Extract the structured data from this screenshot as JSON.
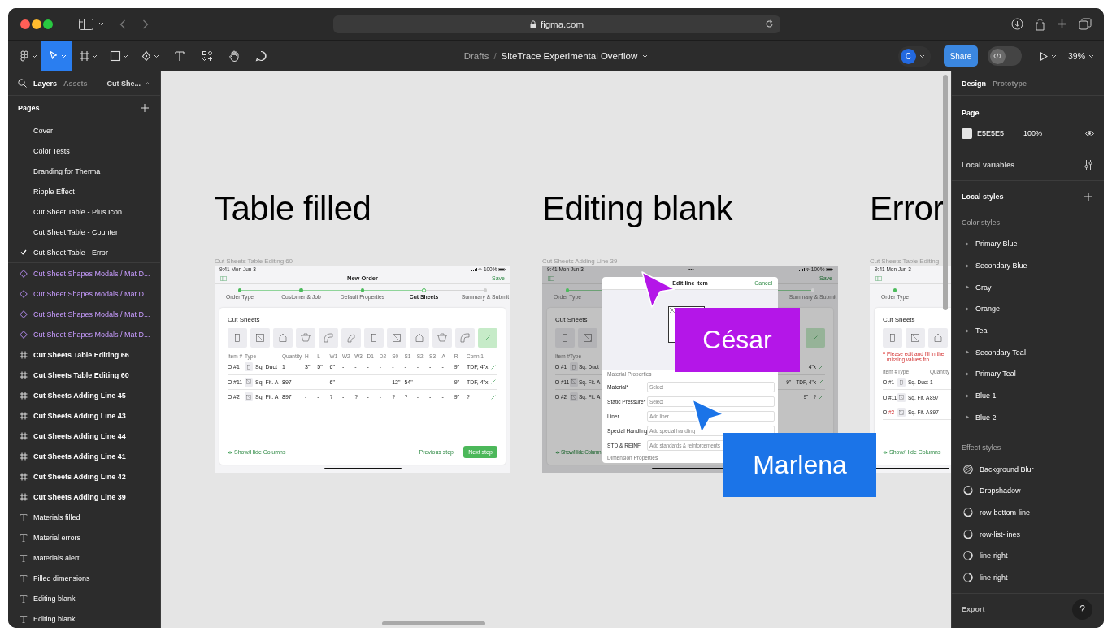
{
  "browser": {
    "url": "figma.com"
  },
  "toolbar": {
    "tools": [
      {
        "selected": false
      },
      {
        "selected": true
      },
      {
        "selected": false
      },
      {
        "selected": false
      },
      {
        "selected": false
      },
      {
        "selected": false
      },
      {
        "selected": false
      },
      {
        "selected": false
      },
      {
        "selected": false
      }
    ],
    "location": "Drafts",
    "separator": "/",
    "file_name": "SiteTrace Experimental Overflow",
    "avatar": "C",
    "share": "Share",
    "dev_mode": false,
    "zoom": "39%"
  },
  "left_panel": {
    "tabs": [
      {
        "label": "Layers",
        "selected": true
      },
      {
        "label": "Assets",
        "selected": false
      }
    ],
    "page_picker": "Cut She...",
    "pages_title": "Pages",
    "pages": [
      {
        "label": "Cover",
        "selected": false
      },
      {
        "label": "Color Tests",
        "selected": false
      },
      {
        "label": "Branding for Therma",
        "selected": false
      },
      {
        "label": "Ripple Effect",
        "selected": false
      },
      {
        "label": "Cut Sheet Table - Plus Icon",
        "selected": false
      },
      {
        "label": "Cut Sheet Table - Counter",
        "selected": false
      },
      {
        "label": "Cut Sheet Table - Error",
        "selected": true
      }
    ],
    "layers": [
      {
        "kind": "component",
        "label": "Cut Sheet Shapes Modals / Mat D..."
      },
      {
        "kind": "component",
        "label": "Cut Sheet Shapes Modals / Mat D..."
      },
      {
        "kind": "component",
        "label": "Cut Sheet Shapes Modals / Mat D..."
      },
      {
        "kind": "component",
        "label": "Cut Sheet Shapes Modals / Mat D..."
      },
      {
        "kind": "frame",
        "label": "Cut Sheets Table Editing 66"
      },
      {
        "kind": "frame",
        "label": "Cut Sheets Table Editing 60"
      },
      {
        "kind": "frame",
        "label": "Cut Sheets Adding Line 45"
      },
      {
        "kind": "frame",
        "label": "Cut Sheets Adding Line 43"
      },
      {
        "kind": "frame",
        "label": "Cut Sheets Adding Line 44"
      },
      {
        "kind": "frame",
        "label": "Cut Sheets Adding Line 41"
      },
      {
        "kind": "frame",
        "label": "Cut Sheets Adding Line 42"
      },
      {
        "kind": "frame",
        "label": "Cut Sheets Adding Line 39"
      },
      {
        "kind": "text",
        "label": "Materials filled"
      },
      {
        "kind": "text",
        "label": "Material errors"
      },
      {
        "kind": "text",
        "label": "Materials alert"
      },
      {
        "kind": "text",
        "label": "Filled dimensions"
      },
      {
        "kind": "text",
        "label": "Editing blank"
      },
      {
        "kind": "text",
        "label": "Editing blank"
      }
    ]
  },
  "canvas": {
    "sections": [
      {
        "heading": "Table filled",
        "frame": {
          "label": "Cut Sheets Table Editing 60",
          "status": {
            "time": "9:41 Mon Jun 3",
            "battery": "100%"
          },
          "nav": {
            "title": "New Order",
            "action": "Save"
          },
          "steps": [
            {
              "label": "Order Type",
              "done": true,
              "current": false
            },
            {
              "label": "Customer & Job",
              "done": true,
              "current": false
            },
            {
              "label": "Default Properties",
              "done": true,
              "current": false
            },
            {
              "label": "Cut Sheets",
              "done": false,
              "current": true
            },
            {
              "label": "Summary & Submit",
              "done": false,
              "current": false
            }
          ],
          "card_title": "Cut Sheets",
          "tiles": [
            {
              "selected": false
            },
            {
              "selected": false
            },
            {
              "selected": false
            },
            {
              "selected": false
            },
            {
              "selected": false
            },
            {
              "selected": false
            },
            {
              "selected": false
            },
            {
              "selected": false
            },
            {
              "selected": false
            },
            {
              "selected": false
            },
            {
              "selected": false
            },
            {
              "selected": true
            }
          ],
          "columns": [
            "Item #",
            "Type",
            "Quantity",
            "H",
            "L",
            "W1",
            "W2",
            "W3",
            "D1",
            "D2",
            "S0",
            "S1",
            "S2",
            "S3",
            "A",
            "R",
            "Conn 1"
          ],
          "rows": [
            {
              "checked": false,
              "error": false,
              "cells": [
                "#1",
                "Sq. Duct",
                "1",
                "3\"",
                "5\"",
                "6\"",
                "-",
                "-",
                "-",
                "-",
                "-",
                "-",
                "-",
                "-",
                "-",
                "9\"",
                "TDF, 4\"x"
              ]
            },
            {
              "checked": false,
              "error": false,
              "cells": [
                "#11",
                "Sq. Fit. A",
                "897",
                "-",
                "-",
                "6\"",
                "-",
                "-",
                "-",
                "-",
                "12\"",
                "54\"",
                "-",
                "-",
                "-",
                "9\"",
                "TDF, 4\"x"
              ]
            },
            {
              "checked": false,
              "error": false,
              "cells": [
                "#2",
                "Sq. Fit. A",
                "897",
                "-",
                "-",
                "?",
                "-",
                "?",
                "-",
                "-",
                "?",
                "?",
                "-",
                "-",
                "-",
                "9\"",
                "?"
              ]
            }
          ],
          "row_edit": true,
          "footer": {
            "toggle": "Show/Hide Columns",
            "previous": "Previous step",
            "next": "Next step"
          }
        }
      },
      {
        "heading": "Editing blank",
        "frame": {
          "label": "Cut Sheets Adding Line 39",
          "status": {
            "time": "9:41 Mon Jun 3",
            "center": "•••",
            "battery": "100%"
          },
          "nav": {
            "action": "Save"
          },
          "steps": [
            {
              "label": "Order Type",
              "done": true,
              "current": false
            },
            {
              "label": "Summary & Submit",
              "done": false,
              "current": false
            }
          ],
          "card_title": "Cut Sheets",
          "tiles": [
            {
              "selected": false
            },
            {
              "selected": false
            },
            {
              "selected": true
            }
          ],
          "columns": [
            "Item #",
            "Type"
          ],
          "rows": [
            {
              "checked": false,
              "error": false,
              "cells": [
                "#1",
                "Sq. Duct"
              ],
              "tail": [
                "4\"x"
              ]
            },
            {
              "checked": false,
              "error": false,
              "cells": [
                "#11",
                "Sq. Fit. A"
              ],
              "tail": [
                "9\"",
                "TDF, 4\"x"
              ]
            },
            {
              "checked": false,
              "error": false,
              "cells": [
                "#2",
                "Sq. Fit. A"
              ],
              "tail": [
                "9\"",
                "?"
              ]
            }
          ],
          "row_edit": true,
          "footer": {
            "toggle": "Show/Hide Column"
          },
          "modal": {
            "title": "Edit line item",
            "cancel": "Cancel",
            "section": "Material Properties",
            "fields": [
              {
                "label": "Material*",
                "placeholder": "Select"
              },
              {
                "label": "Static Pressure*",
                "placeholder": "Select"
              },
              {
                "label": "Liner",
                "placeholder": "Add liner"
              },
              {
                "label": "Special Handling",
                "placeholder": "Add special handling"
              },
              {
                "label": "STD & REINF",
                "placeholder": "Add standards & reinforcements"
              }
            ],
            "next_section": "Dimension Properties"
          }
        }
      },
      {
        "heading": "Error",
        "frame": {
          "label": "Cut Sheets Table Editing",
          "status": {
            "time": "9:41 Mon Jun 3"
          },
          "steps": [
            {
              "label": "Order Type",
              "done": true,
              "current": false
            }
          ],
          "card_title": "Cut Sheets",
          "tiles": [
            {
              "selected": false
            },
            {
              "selected": false
            },
            {
              "selected": false
            }
          ],
          "error": "Please edit and fill in the missing values fro",
          "columns": [
            "Item #",
            "Type",
            "Quantity"
          ],
          "rows": [
            {
              "checked": false,
              "error": false,
              "cells": [
                "#1",
                "Sq. Duct",
                "1"
              ]
            },
            {
              "checked": false,
              "error": false,
              "cells": [
                "#11",
                "Sq. Fit. A",
                "897"
              ]
            },
            {
              "checked": false,
              "error": true,
              "cells": [
                "#2",
                "Sq. Fit. A",
                "897"
              ]
            }
          ],
          "footer": {
            "toggle": "Show/Hide Columns"
          }
        }
      }
    ],
    "cursors": [
      {
        "name": "César",
        "color": "#b416e8"
      },
      {
        "name": "Marlena",
        "color": "#1b74e8"
      }
    ]
  },
  "right_panel": {
    "tabs": [
      {
        "label": "Design",
        "selected": true
      },
      {
        "label": "Prototype",
        "selected": false
      }
    ],
    "page": {
      "title": "Page",
      "fill": "E5E5E5",
      "opacity": "100%"
    },
    "local_variables": "Local variables",
    "local_styles": "Local styles",
    "color_styles": {
      "title": "Color styles",
      "items": [
        "Primary Blue",
        "Secondary Blue",
        "Gray",
        "Orange",
        "Teal",
        "Secondary Teal",
        "Primary Teal",
        "Blue 1",
        "Blue 2"
      ]
    },
    "effect_styles": {
      "title": "Effect styles",
      "items": [
        {
          "label": "Background Blur",
          "kind": "blur"
        },
        {
          "label": "Dropshadow",
          "kind": "shadow"
        },
        {
          "label": "row-bottom-line",
          "kind": "shadow"
        },
        {
          "label": "row-list-lines",
          "kind": "shadow"
        },
        {
          "label": "line-right",
          "kind": "inner"
        },
        {
          "label": "line-right",
          "kind": "inner"
        }
      ]
    },
    "export": "Export",
    "help": "?"
  }
}
